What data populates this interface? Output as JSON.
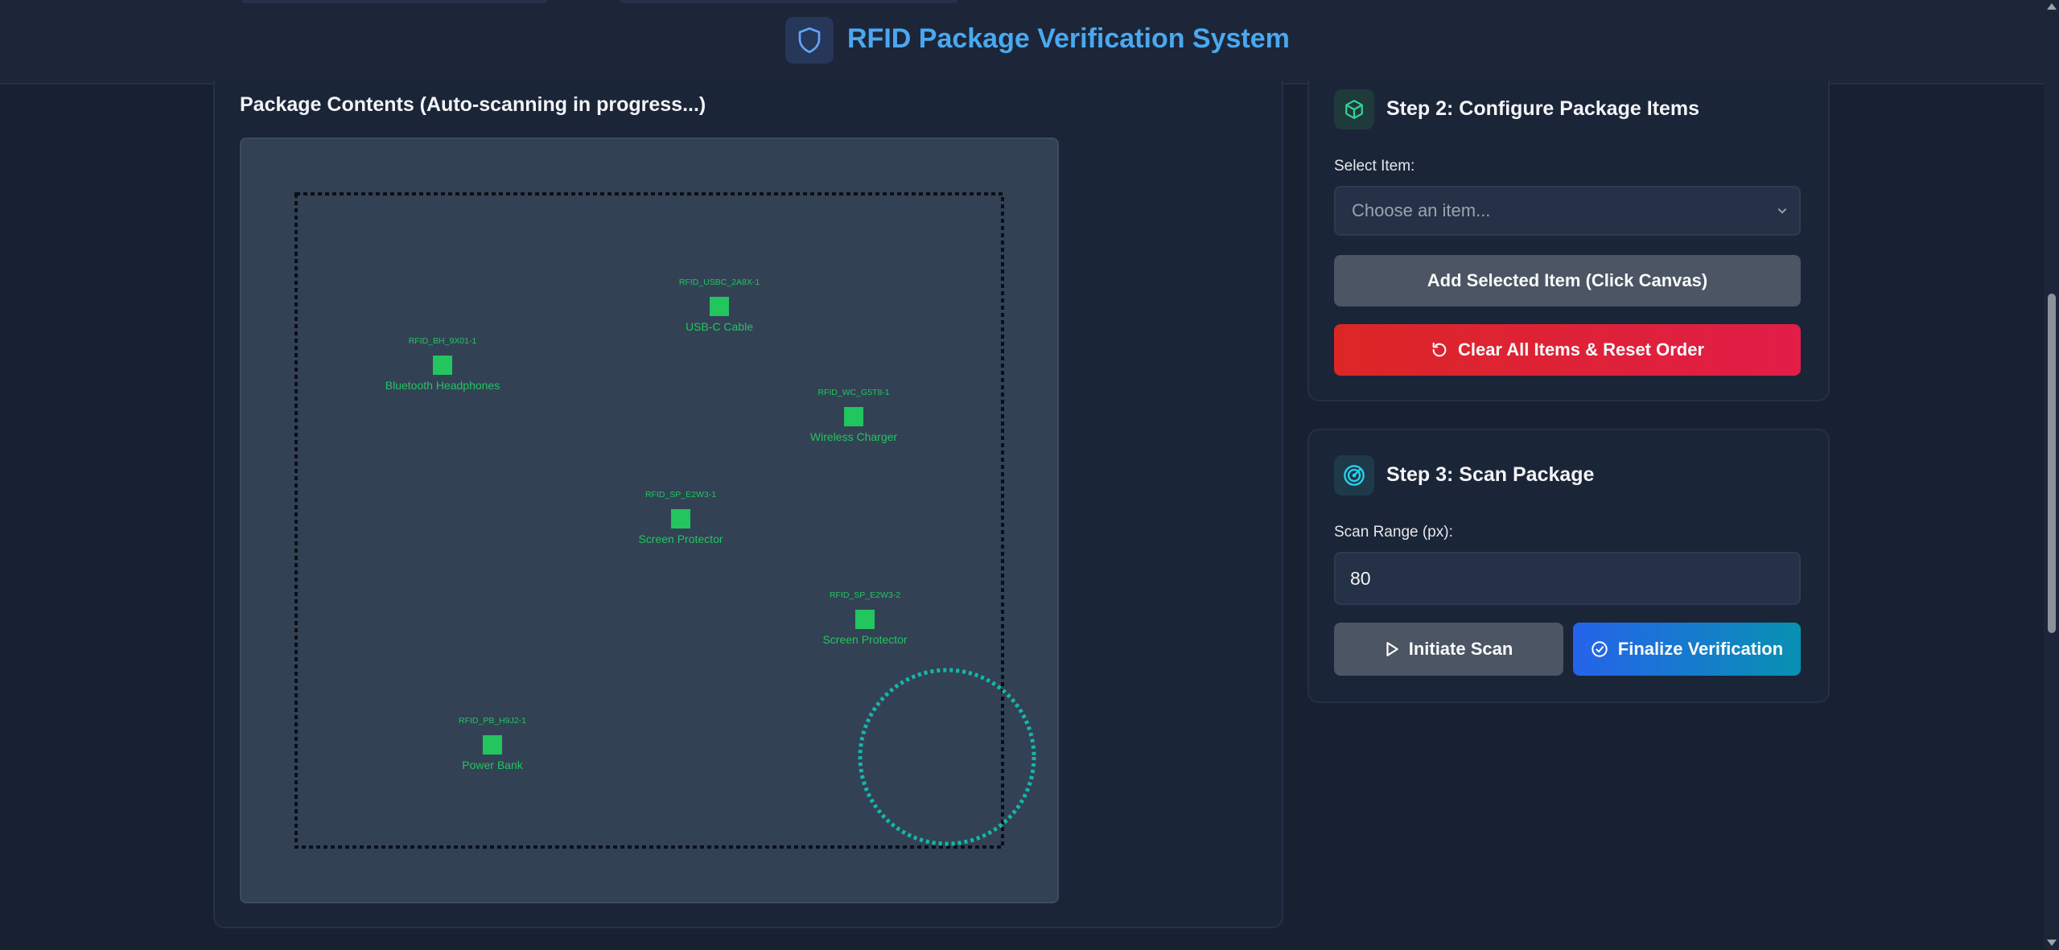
{
  "app": {
    "title": "RFID Package Verification System",
    "logo_icon": "shield-icon"
  },
  "canvas_section": {
    "title": "Package Contents (Auto-scanning in progress...)",
    "items": [
      {
        "rfid": "RFID_USBC_2A8X-1",
        "name": "USB-C Cable"
      },
      {
        "rfid": "RFID_BH_9X01-1",
        "name": "Bluetooth Headphones"
      },
      {
        "rfid": "RFID_WC_G5T8-1",
        "name": "Wireless Charger"
      },
      {
        "rfid": "RFID_SP_E2W3-1",
        "name": "Screen Protector"
      },
      {
        "rfid": "RFID_SP_E2W3-2",
        "name": "Screen Protector"
      },
      {
        "rfid": "RFID_PB_H9J2-1",
        "name": "Power Bank"
      }
    ],
    "item_color": "#22c55e",
    "scanner_color": "#14b8a6"
  },
  "step2": {
    "title": "Step 2: Configure Package Items",
    "icon": "box-icon",
    "select_label": "Select Item:",
    "select_value": "Choose an item...",
    "add_button": "Add Selected Item (Click Canvas)",
    "clear_button": "Clear All Items & Reset Order"
  },
  "step3": {
    "title": "Step 3: Scan Package",
    "icon": "radar-icon",
    "range_label": "Scan Range (px):",
    "range_value": "80",
    "scan_button": "Initiate Scan",
    "finalize_button": "Finalize Verification"
  },
  "colors": {
    "background": "#172131",
    "accent": "#4aa8f0",
    "danger": "#dc2626",
    "primary": "#2563eb"
  }
}
